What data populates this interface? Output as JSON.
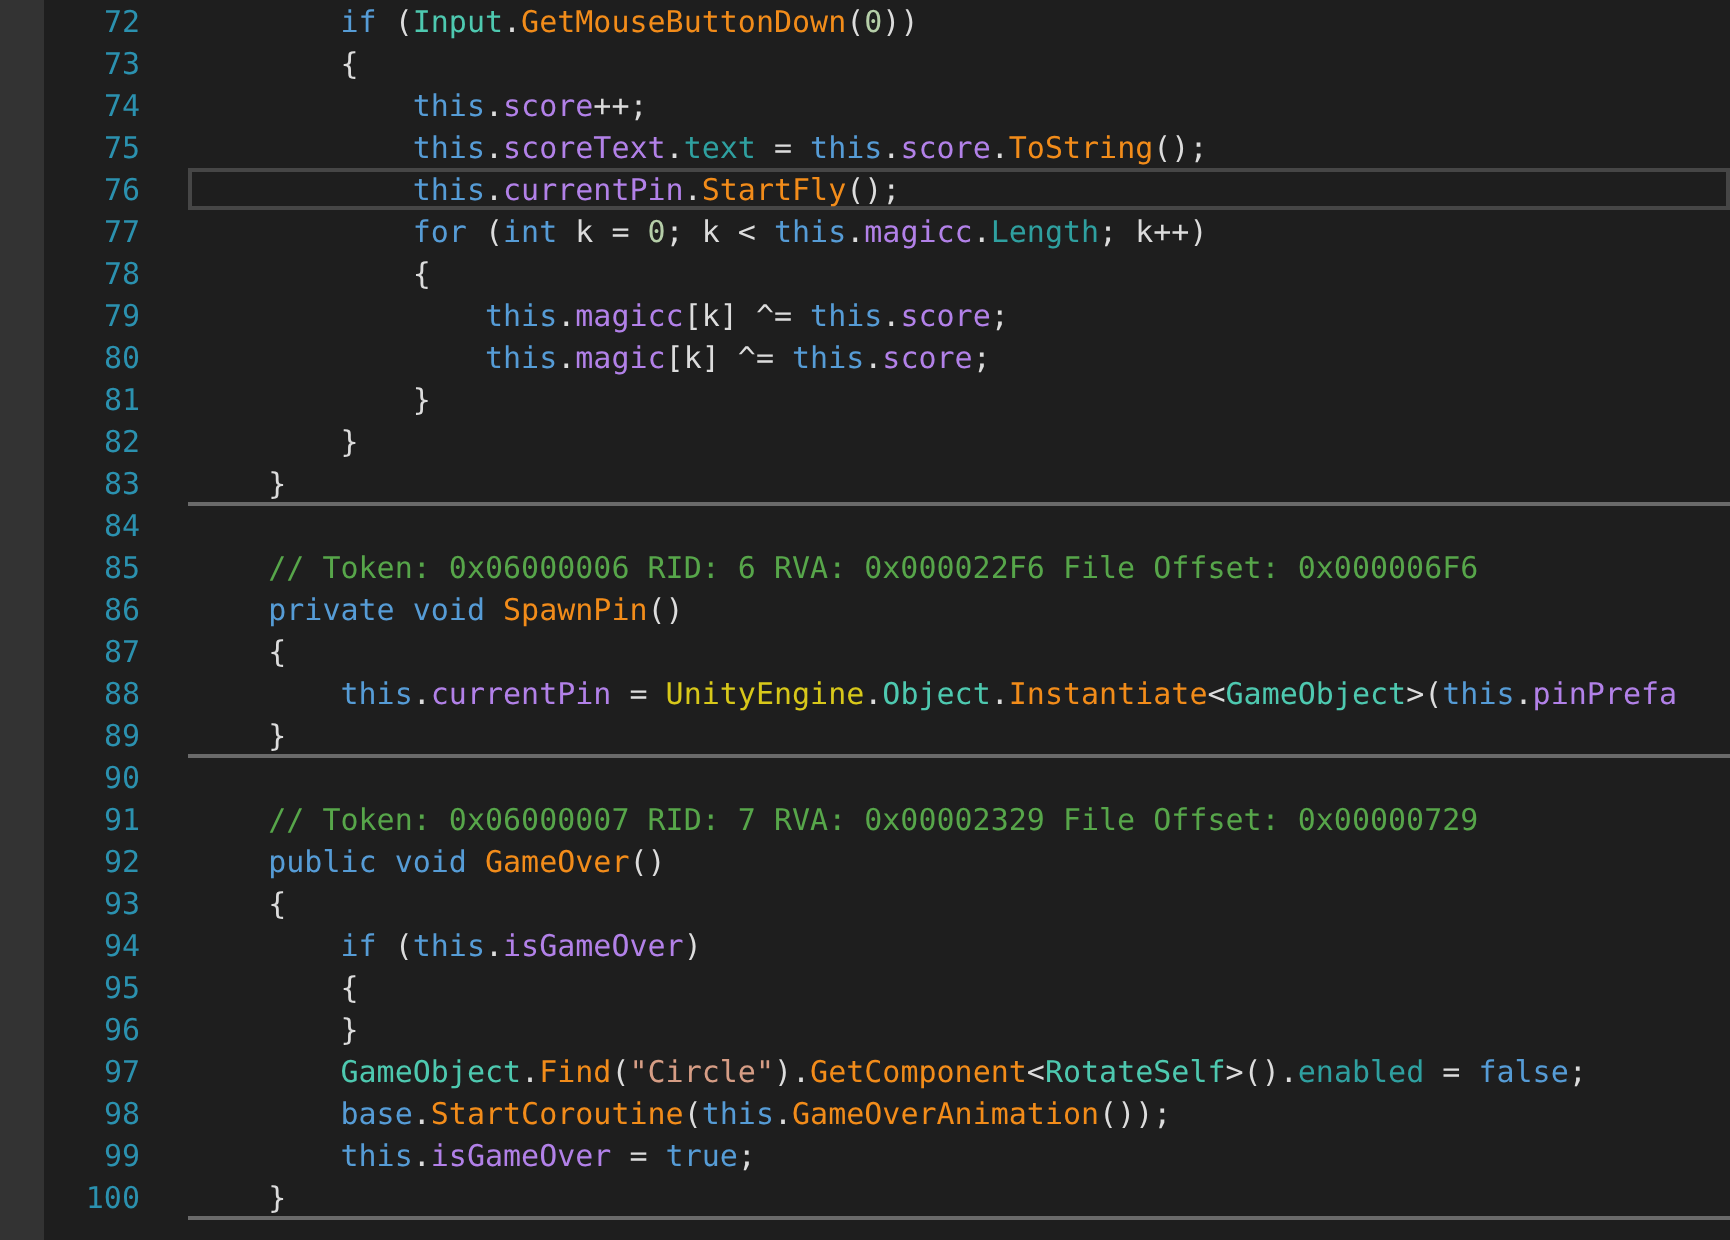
{
  "editor": {
    "lines": [
      {
        "children": [
          {
            "number": "72",
            "current": false,
            "separator_after": false,
            "tokens": [
              {
                "kind": "kw",
                "text": "if "
              },
              {
                "kind": "x",
                "text": "("
              },
              {
                "kind": "type",
                "text": "Input"
              },
              {
                "kind": "x",
                "text": "."
              },
              {
                "kind": "method",
                "text": "GetMouseButtonDown"
              },
              {
                "kind": "x",
                "text": "("
              },
              {
                "kind": "num",
                "text": "0"
              },
              {
                "kind": "x",
                "text": "))"
              }
            ]
          },
          {
            "number": "73",
            "current": false,
            "separator_after": false,
            "tokens": [
              {
                "kind": "x",
                "text": "{"
              }
            ],
            "children": [
              {
                "number": "74",
                "current": false,
                "separator_after": false,
                "tokens": [
                  {
                    "kind": "kw",
                    "text": "this"
                  },
                  {
                    "kind": "x",
                    "text": "."
                  },
                  {
                    "kind": "field",
                    "text": "score"
                  },
                  {
                    "kind": "x",
                    "text": "++;"
                  }
                ]
              },
              {
                "number": "75",
                "current": false,
                "separator_after": false,
                "tokens": [
                  {
                    "kind": "kw",
                    "text": "this"
                  },
                  {
                    "kind": "x",
                    "text": "."
                  },
                  {
                    "kind": "field",
                    "text": "scoreText"
                  },
                  {
                    "kind": "x",
                    "text": "."
                  },
                  {
                    "kind": "prop",
                    "text": "text"
                  },
                  {
                    "kind": "x",
                    "text": " = "
                  },
                  {
                    "kind": "kw",
                    "text": "this"
                  },
                  {
                    "kind": "x",
                    "text": "."
                  },
                  {
                    "kind": "field",
                    "text": "score"
                  },
                  {
                    "kind": "x",
                    "text": "."
                  },
                  {
                    "kind": "method",
                    "text": "ToString"
                  },
                  {
                    "kind": "x",
                    "text": "();"
                  }
                ]
              },
              {
                "number": "76",
                "current": true,
                "separator_after": false,
                "tokens": [
                  {
                    "kind": "kw",
                    "text": "this"
                  },
                  {
                    "kind": "x",
                    "text": "."
                  },
                  {
                    "kind": "field",
                    "text": "currentPin"
                  },
                  {
                    "kind": "x",
                    "text": "."
                  },
                  {
                    "kind": "method",
                    "text": "StartFly"
                  },
                  {
                    "kind": "x",
                    "text": "();"
                  }
                ]
              },
              {
                "number": "77",
                "current": false,
                "separator_after": false,
                "tokens": [
                  {
                    "kind": "kw",
                    "text": "for "
                  },
                  {
                    "kind": "x",
                    "text": "("
                  },
                  {
                    "kind": "kw",
                    "text": "int"
                  },
                  {
                    "kind": "x",
                    "text": " k = "
                  },
                  {
                    "kind": "num",
                    "text": "0"
                  },
                  {
                    "kind": "x",
                    "text": "; k < "
                  },
                  {
                    "kind": "kw",
                    "text": "this"
                  },
                  {
                    "kind": "x",
                    "text": "."
                  },
                  {
                    "kind": "field",
                    "text": "magicc"
                  },
                  {
                    "kind": "x",
                    "text": "."
                  },
                  {
                    "kind": "prop",
                    "text": "Length"
                  },
                  {
                    "kind": "x",
                    "text": "; k++)"
                  }
                ]
              },
              {
                "number": "78",
                "current": false,
                "separator_after": false,
                "tokens": [
                  {
                    "kind": "x",
                    "text": "{"
                  }
                ],
                "children": [
                  {
                    "number": "79",
                    "current": false,
                    "separator_after": false,
                    "tokens": [
                      {
                        "kind": "kw",
                        "text": "this"
                      },
                      {
                        "kind": "x",
                        "text": "."
                      },
                      {
                        "kind": "field",
                        "text": "magicc"
                      },
                      {
                        "kind": "x",
                        "text": "[k] ^= "
                      },
                      {
                        "kind": "kw",
                        "text": "this"
                      },
                      {
                        "kind": "x",
                        "text": "."
                      },
                      {
                        "kind": "field",
                        "text": "score"
                      },
                      {
                        "kind": "x",
                        "text": ";"
                      }
                    ]
                  },
                  {
                    "number": "80",
                    "current": false,
                    "separator_after": false,
                    "tokens": [
                      {
                        "kind": "kw",
                        "text": "this"
                      },
                      {
                        "kind": "x",
                        "text": "."
                      },
                      {
                        "kind": "field",
                        "text": "magic"
                      },
                      {
                        "kind": "x",
                        "text": "[k] ^= "
                      },
                      {
                        "kind": "kw",
                        "text": "this"
                      },
                      {
                        "kind": "x",
                        "text": "."
                      },
                      {
                        "kind": "field",
                        "text": "score"
                      },
                      {
                        "kind": "x",
                        "text": ";"
                      }
                    ]
                  }
                ]
              },
              {
                "number": "81",
                "current": false,
                "separator_after": false,
                "tokens": [
                  {
                    "kind": "x",
                    "text": "}"
                  }
                ]
              }
            ]
          },
          {
            "number": "82",
            "current": false,
            "separator_after": false,
            "tokens": [
              {
                "kind": "x",
                "text": "}"
              }
            ]
          }
        ]
      },
      {
        "number": "83",
        "current": false,
        "separator_after": true,
        "tokens": [
          {
            "kind": "x",
            "text": "}"
          }
        ]
      },
      {
        "number": "84",
        "current": false,
        "separator_after": false
      },
      {
        "number": "85",
        "current": false,
        "separator_after": false,
        "tokens": [
          {
            "kind": "comment",
            "text": "// Token: 0x06000006 RID: 6 RVA: 0x000022F6 File Offset: 0x000006F6"
          }
        ]
      },
      {
        "number": "86",
        "current": false,
        "separator_after": false,
        "tokens": [
          {
            "kind": "kw",
            "text": "private void "
          },
          {
            "kind": "method",
            "text": "SpawnPin"
          },
          {
            "kind": "x",
            "text": "()"
          }
        ]
      },
      {
        "number": "87",
        "current": false,
        "separator_after": false,
        "tokens": [
          {
            "kind": "x",
            "text": "{"
          }
        ],
        "children": [
          {
            "number": "88",
            "current": false,
            "separator_after": false,
            "tokens": [
              {
                "kind": "kw",
                "text": "this"
              },
              {
                "kind": "x",
                "text": "."
              },
              {
                "kind": "field",
                "text": "currentPin"
              },
              {
                "kind": "x",
                "text": " = "
              },
              {
                "kind": "ns",
                "text": "UnityEngine"
              },
              {
                "kind": "x",
                "text": "."
              },
              {
                "kind": "type",
                "text": "Object"
              },
              {
                "kind": "x",
                "text": "."
              },
              {
                "kind": "method",
                "text": "Instantiate"
              },
              {
                "kind": "x",
                "text": "<"
              },
              {
                "kind": "type",
                "text": "GameObject"
              },
              {
                "kind": "x",
                "text": ">("
              },
              {
                "kind": "kw",
                "text": "this"
              },
              {
                "kind": "x",
                "text": "."
              },
              {
                "kind": "field",
                "text": "pinPrefa"
              }
            ]
          }
        ]
      },
      {
        "number": "89",
        "current": false,
        "separator_after": true,
        "tokens": [
          {
            "kind": "x",
            "text": "}"
          }
        ]
      },
      {
        "number": "90",
        "current": false,
        "separator_after": false
      },
      {
        "number": "91",
        "current": false,
        "separator_after": false,
        "tokens": [
          {
            "kind": "comment",
            "text": "// Token: 0x06000007 RID: 7 RVA: 0x00002329 File Offset: 0x00000729"
          }
        ]
      },
      {
        "number": "92",
        "current": false,
        "separator_after": false,
        "tokens": [
          {
            "kind": "kw",
            "text": "public void "
          },
          {
            "kind": "method",
            "text": "GameOver"
          },
          {
            "kind": "x",
            "text": "()"
          }
        ]
      },
      {
        "number": "93",
        "current": false,
        "separator_after": false,
        "tokens": [
          {
            "kind": "x",
            "text": "{"
          }
        ],
        "children": [
          {
            "number": "94",
            "current": false,
            "separator_after": false,
            "tokens": [
              {
                "kind": "kw",
                "text": "if "
              },
              {
                "kind": "x",
                "text": "("
              },
              {
                "kind": "kw",
                "text": "this"
              },
              {
                "kind": "x",
                "text": "."
              },
              {
                "kind": "field",
                "text": "isGameOver"
              },
              {
                "kind": "x",
                "text": ")"
              }
            ]
          },
          {
            "number": "95",
            "current": false,
            "separator_after": false,
            "tokens": [
              {
                "kind": "x",
                "text": "{"
              }
            ]
          },
          {
            "number": "96",
            "current": false,
            "separator_after": false,
            "tokens": [
              {
                "kind": "x",
                "text": "}"
              }
            ]
          },
          {
            "number": "97",
            "current": false,
            "separator_after": false,
            "tokens": [
              {
                "kind": "type",
                "text": "GameObject"
              },
              {
                "kind": "x",
                "text": "."
              },
              {
                "kind": "method",
                "text": "Find"
              },
              {
                "kind": "x",
                "text": "("
              },
              {
                "kind": "str",
                "text": "\"Circle\""
              },
              {
                "kind": "x",
                "text": ")."
              },
              {
                "kind": "method",
                "text": "GetComponent"
              },
              {
                "kind": "x",
                "text": "<"
              },
              {
                "kind": "type",
                "text": "RotateSelf"
              },
              {
                "kind": "x",
                "text": ">()."
              },
              {
                "kind": "prop",
                "text": "enabled"
              },
              {
                "kind": "x",
                "text": " = "
              },
              {
                "kind": "kw",
                "text": "false"
              },
              {
                "kind": "x",
                "text": ";"
              }
            ]
          },
          {
            "number": "98",
            "current": false,
            "separator_after": false,
            "tokens": [
              {
                "kind": "kw",
                "text": "base"
              },
              {
                "kind": "x",
                "text": "."
              },
              {
                "kind": "method",
                "text": "StartCoroutine"
              },
              {
                "kind": "x",
                "text": "("
              },
              {
                "kind": "kw",
                "text": "this"
              },
              {
                "kind": "x",
                "text": "."
              },
              {
                "kind": "method",
                "text": "GameOverAnimation"
              },
              {
                "kind": "x",
                "text": "());"
              }
            ]
          },
          {
            "number": "99",
            "current": false,
            "separator_after": false,
            "tokens": [
              {
                "kind": "kw",
                "text": "this"
              },
              {
                "kind": "x",
                "text": "."
              },
              {
                "kind": "field",
                "text": "isGameOver"
              },
              {
                "kind": "x",
                "text": " = "
              },
              {
                "kind": "kw",
                "text": "true"
              },
              {
                "kind": "x",
                "text": ";"
              }
            ]
          }
        ]
      },
      {
        "number": "100",
        "current": false,
        "separator_after": true,
        "tokens": [
          {
            "kind": "x",
            "text": "}"
          }
        ]
      }
    ]
  }
}
